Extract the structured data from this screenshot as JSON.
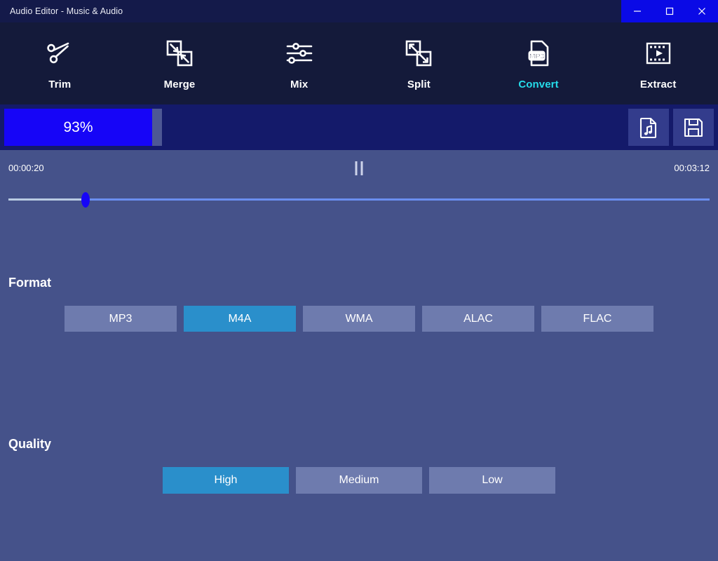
{
  "window": {
    "title": "Audio Editor - Music & Audio",
    "controls": [
      {
        "name": "minimize",
        "glyph": "minimize-icon"
      },
      {
        "name": "maximize",
        "glyph": "maximize-icon"
      },
      {
        "name": "close",
        "glyph": "close-icon"
      }
    ],
    "titlebar_bg": "#141a4a",
    "controls_bg": "#0a0ae6"
  },
  "toolbar": {
    "items": [
      {
        "label": "Trim",
        "icon": "scissors-icon",
        "active": false
      },
      {
        "label": "Merge",
        "icon": "merge-squares-icon",
        "active": false
      },
      {
        "label": "Mix",
        "icon": "sliders-icon",
        "active": false
      },
      {
        "label": "Split",
        "icon": "split-squares-icon",
        "active": false
      },
      {
        "label": "Convert",
        "icon": "mp3-file-icon",
        "active": true
      },
      {
        "label": "Extract",
        "icon": "film-strip-icon",
        "active": false
      }
    ],
    "active_color": "#25dcea",
    "bg": "#141a3a"
  },
  "progress": {
    "percent_label": "93%",
    "percent_value": 93,
    "fill_color": "#1605f7",
    "track_color": "#141a6a",
    "buttons": [
      {
        "name": "music-file-button",
        "icon": "music-file-icon"
      },
      {
        "name": "save-button",
        "icon": "save-floppy-icon"
      }
    ]
  },
  "player": {
    "current_time": "00:00:20",
    "total_time": "00:03:12",
    "transport_icon": "pause-icon",
    "seek_position_percent": 11,
    "thumb_color": "#1605f7"
  },
  "format": {
    "title": "Format",
    "options": [
      {
        "label": "MP3",
        "selected": false
      },
      {
        "label": "M4A",
        "selected": true
      },
      {
        "label": "WMA",
        "selected": false
      },
      {
        "label": "ALAC",
        "selected": false
      },
      {
        "label": "FLAC",
        "selected": false
      }
    ]
  },
  "quality": {
    "title": "Quality",
    "options": [
      {
        "label": "High",
        "selected": true
      },
      {
        "label": "Medium",
        "selected": false
      },
      {
        "label": "Low",
        "selected": false
      }
    ]
  },
  "theme": {
    "background": "#45528a",
    "selected_button": "#2a8fcb",
    "unselected_button": "#6e7bae"
  }
}
